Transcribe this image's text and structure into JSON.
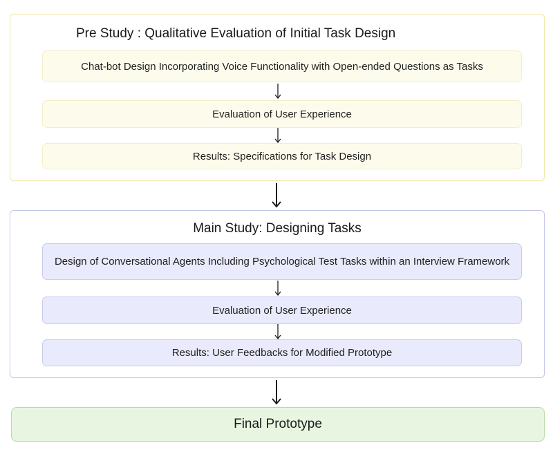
{
  "pre_study": {
    "title": "Pre Study : Qualitative Evaluation of Initial Task Design",
    "steps": [
      "Chat-bot Design Incorporating Voice Functionality with Open-ended Questions as Tasks",
      "Evaluation of User Experience",
      "Results: Specifications for Task Design"
    ]
  },
  "main_study": {
    "title": "Main Study: Designing Tasks",
    "steps": [
      "Design of Conversational Agents Including Psychological Test Tasks within an Interview Framework",
      "Evaluation of User Experience",
      "Results: User Feedbacks for Modified Prototype"
    ]
  },
  "final": {
    "label": "Final Prototype"
  },
  "colors": {
    "pre_border": "#eee9a6",
    "pre_box_fill": "#fdfcec",
    "main_border": "#c3c6ea",
    "main_box_fill": "#e9eafb",
    "final_fill": "#e8f6e1",
    "final_border": "#b9d9a8",
    "arrow": "#1a1a1a"
  }
}
